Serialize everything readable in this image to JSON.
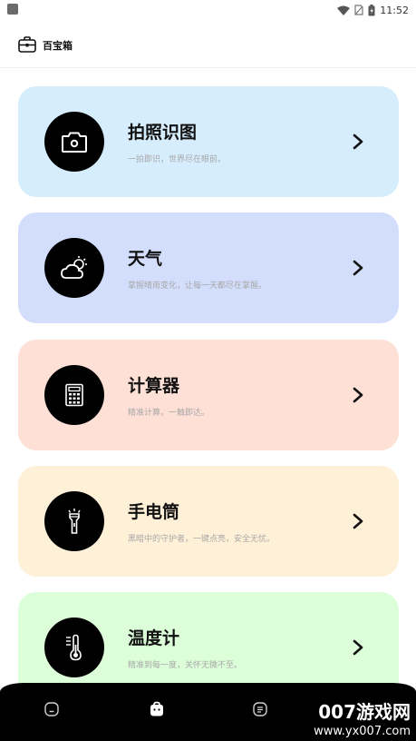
{
  "status_bar": {
    "time": "11:52"
  },
  "header": {
    "title": "百宝箱",
    "icon": "toolbox-icon"
  },
  "cards": [
    {
      "title": "拍照识图",
      "desc": "一拍即识，世界尽在眼前。",
      "color": "#d6edfd",
      "icon": "camera-icon"
    },
    {
      "title": "天气",
      "desc": "掌握晴雨变化，让每一天都尽在掌握。",
      "color": "#d3defd",
      "icon": "weather-icon"
    },
    {
      "title": "计算器",
      "desc": "精准计算，一触即达。",
      "color": "#fee0d7",
      "icon": "calculator-icon"
    },
    {
      "title": "手电筒",
      "desc": "黑暗中的守护者，一键点亮，安全无忧。",
      "color": "#fff0d8",
      "icon": "flashlight-icon"
    },
    {
      "title": "温度计",
      "desc": "精准到每一度，关怀无微不至。",
      "color": "#dcfed9",
      "icon": "thermometer-icon"
    }
  ],
  "bottom_nav": {
    "items": [
      {
        "icon": "home-icon"
      },
      {
        "icon": "toolbox-icon",
        "active": true
      },
      {
        "icon": "list-icon"
      }
    ]
  },
  "watermark": {
    "main": "007游戏网",
    "url": "www.yx007.com"
  }
}
